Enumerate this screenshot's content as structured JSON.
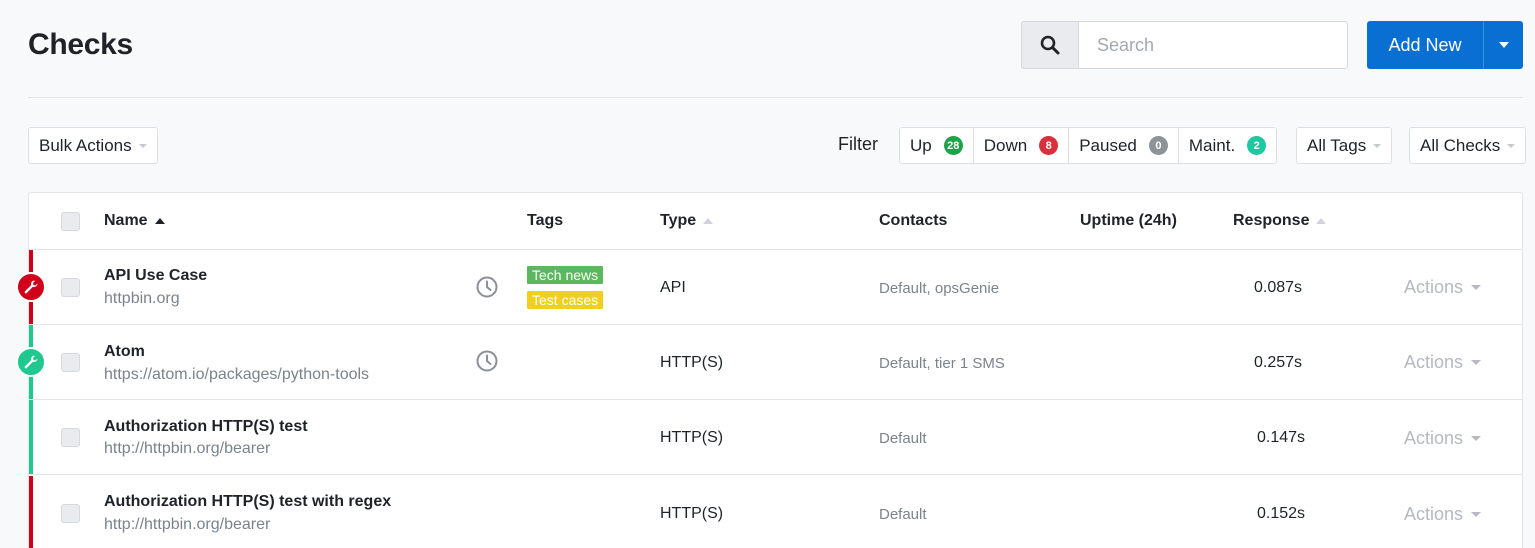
{
  "page": {
    "title": "Checks"
  },
  "search": {
    "placeholder": "Search"
  },
  "add_new": {
    "label": "Add New"
  },
  "bulk_actions": {
    "label": "Bulk Actions"
  },
  "filter": {
    "label": "Filter",
    "items": [
      {
        "label": "Up",
        "count": "28",
        "color": "#1fa34a"
      },
      {
        "label": "Down",
        "count": "8",
        "color": "#d9303e"
      },
      {
        "label": "Paused",
        "count": "0",
        "color": "#8c9399"
      },
      {
        "label": "Maint.",
        "count": "2",
        "color": "#1fc8a0"
      }
    ]
  },
  "all_tags": {
    "label": "All Tags"
  },
  "all_checks": {
    "label": "All Checks"
  },
  "table": {
    "headers": {
      "name": "Name",
      "tags": "Tags",
      "type": "Type",
      "contacts": "Contacts",
      "uptime": "Uptime (24h)",
      "response": "Response"
    },
    "rows": [
      {
        "name": "API Use Case",
        "url": "httpbin.org",
        "status": "down",
        "maintenance": true,
        "scheduled": true,
        "tags": [
          {
            "label": "Tech news",
            "color": "#5cb85c"
          },
          {
            "label": "Test cases",
            "color": "#f2cf1d"
          }
        ],
        "type": "API",
        "contacts": "Default, opsGenie",
        "response": "0.087s",
        "actions": "Actions"
      },
      {
        "name": "Atom",
        "url": "https://atom.io/packages/python-tools",
        "status": "up",
        "maintenance": true,
        "scheduled": true,
        "tags": [],
        "type": "HTTP(S)",
        "contacts": "Default, tier 1 SMS",
        "response": "0.257s",
        "actions": "Actions"
      },
      {
        "name": "Authorization HTTP(S) test",
        "url": "http://httpbin.org/bearer",
        "status": "up",
        "maintenance": false,
        "scheduled": false,
        "tags": [],
        "type": "HTTP(S)",
        "contacts": "Default",
        "response": "0.147s",
        "actions": "Actions"
      },
      {
        "name": "Authorization HTTP(S) test with regex",
        "url": "http://httpbin.org/bearer",
        "status": "down",
        "maintenance": false,
        "scheduled": false,
        "tags": [],
        "type": "HTTP(S)",
        "contacts": "Default",
        "response": "0.152s",
        "actions": "Actions"
      }
    ]
  },
  "colors": {
    "primary": "#0a6fd3",
    "down": "#d0021b",
    "up": "#1fc88e"
  },
  "icons": {
    "search": "search-icon",
    "maintenance": "wrench-icon",
    "scheduled": "clock-icon",
    "dropdown": "caret-down-icon"
  }
}
